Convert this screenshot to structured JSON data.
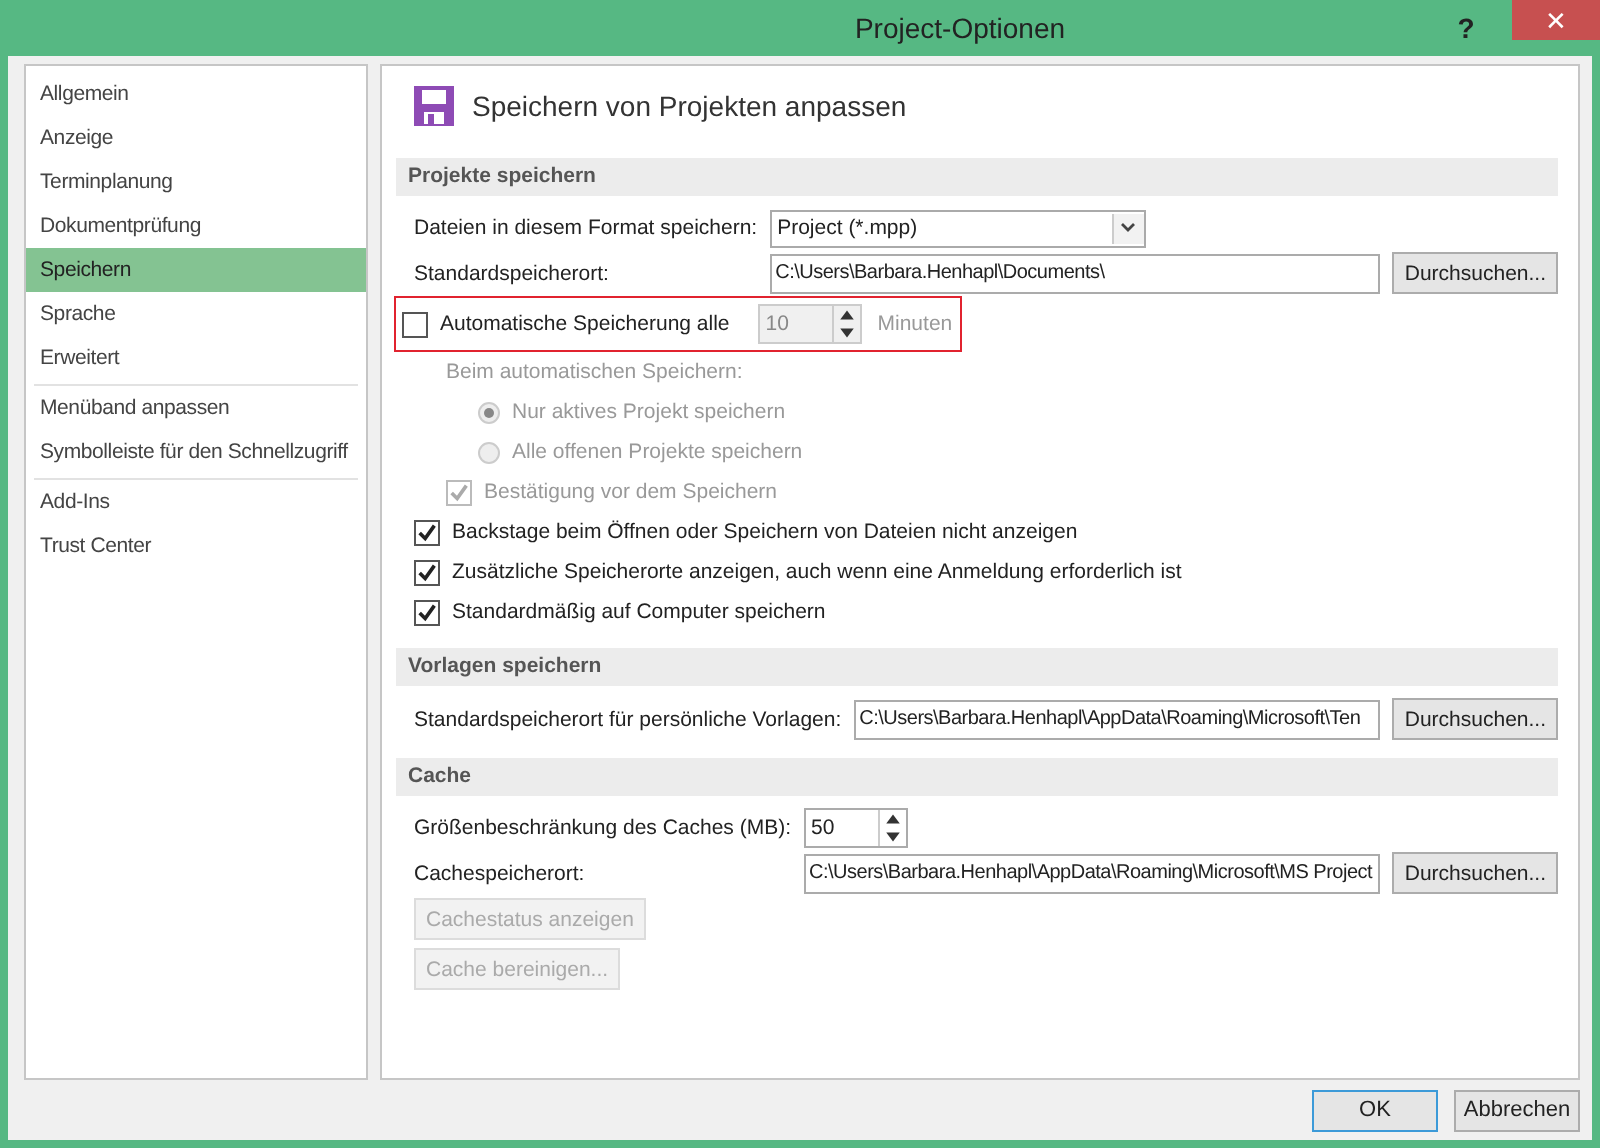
{
  "window": {
    "title": "Project-Optionen",
    "help": "?",
    "close": "✕"
  },
  "sidebar": {
    "groups": [
      {
        "items": [
          {
            "label": "Allgemein",
            "selected": false
          },
          {
            "label": "Anzeige",
            "selected": false
          },
          {
            "label": "Terminplanung",
            "selected": false
          },
          {
            "label": "Dokumentprüfung",
            "selected": false
          },
          {
            "label": "Speichern",
            "selected": true
          },
          {
            "label": "Sprache",
            "selected": false
          },
          {
            "label": "Erweitert",
            "selected": false
          }
        ]
      },
      {
        "items": [
          {
            "label": "Menüband anpassen",
            "selected": false
          },
          {
            "label": "Symbolleiste für den Schnellzugriff",
            "selected": false
          }
        ]
      },
      {
        "items": [
          {
            "label": "Add-Ins",
            "selected": false
          },
          {
            "label": "Trust Center",
            "selected": false
          }
        ]
      }
    ]
  },
  "page": {
    "title": "Speichern von Projekten anpassen",
    "sections": [
      {
        "title": "Projekte speichern",
        "rows": [
          {
            "kind": "select",
            "label": "Dateien in diesem Format speichern:",
            "value": "Project (*.mpp)"
          },
          {
            "kind": "path",
            "label": "Standardspeicherort:",
            "value": "C:\\Users\\Barbara.Henhapl\\Documents\\",
            "button": "Durchsuchen..."
          },
          {
            "kind": "autosave",
            "label": "Automatische Speicherung alle",
            "checked": false,
            "value": "10",
            "unit": "Minuten",
            "disabled": true,
            "highlighted": true,
            "children": [
              {
                "kind": "note",
                "text": "Beim automatischen Speichern:",
                "disabled": true,
                "children": [
                  {
                    "kind": "radio",
                    "label": "Nur aktives Projekt speichern",
                    "selected": true,
                    "disabled": true
                  },
                  {
                    "kind": "radio",
                    "label": "Alle offenen Projekte speichern",
                    "selected": false,
                    "disabled": true
                  }
                ]
              },
              {
                "kind": "checkbox",
                "label": "Bestätigung vor dem Speichern",
                "checked": true,
                "disabled": true
              }
            ]
          },
          {
            "kind": "checkbox",
            "label": "Backstage beim Öffnen oder Speichern von Dateien nicht anzeigen",
            "checked": true,
            "disabled": false
          },
          {
            "kind": "checkbox",
            "label": "Zusätzliche Speicherorte anzeigen, auch wenn eine Anmeldung erforderlich ist",
            "checked": true,
            "disabled": false
          },
          {
            "kind": "checkbox",
            "label": "Standardmäßig auf Computer speichern",
            "checked": true,
            "disabled": false
          }
        ]
      },
      {
        "title": "Vorlagen speichern",
        "rows": [
          {
            "kind": "path",
            "label": "Standardspeicherort für persönliche Vorlagen:",
            "value": "C:\\Users\\Barbara.Henhapl\\AppData\\Roaming\\Microsoft\\Ten",
            "button": "Durchsuchen..."
          }
        ]
      },
      {
        "title": "Cache",
        "rows": [
          {
            "kind": "spinner",
            "label": "Größenbeschränkung des Caches (MB):",
            "value": "50"
          },
          {
            "kind": "path",
            "label": "Cachespeicherort:",
            "value": "C:\\Users\\Barbara.Henhapl\\AppData\\Roaming\\Microsoft\\MS Project",
            "button": "Durchsuchen..."
          },
          {
            "kind": "button",
            "label": "Cachestatus anzeigen",
            "disabled": true
          },
          {
            "kind": "button",
            "label": "Cache bereinigen...",
            "disabled": true
          }
        ]
      }
    ]
  },
  "footer": {
    "buttons": [
      {
        "label": "OK",
        "default": true
      },
      {
        "label": "Abbrechen",
        "default": false
      }
    ]
  }
}
